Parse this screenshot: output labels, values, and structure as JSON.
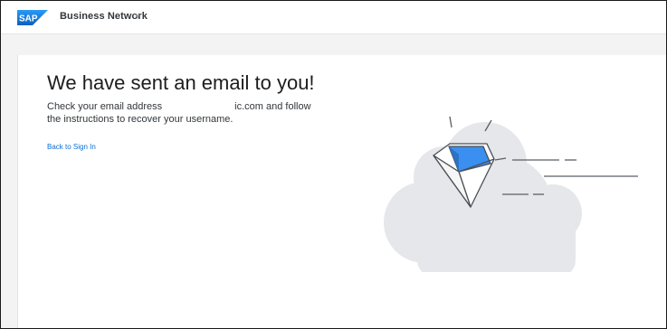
{
  "header": {
    "logo_text": "SAP",
    "app_title": "Business Network",
    "title_chevron_icon": "chevron-down-icon"
  },
  "main": {
    "heading": "We have sent an email to you!",
    "message_line1_start": "Check your email address",
    "message_line1_end": "ic.com and follow",
    "message_line2": "the instructions to recover your username.",
    "back_link": "Back to Sign In"
  },
  "colors": {
    "brand": "#0a6ed1",
    "envelope_blue": "#3a8ff0",
    "cloud": "#e6e7ea"
  }
}
